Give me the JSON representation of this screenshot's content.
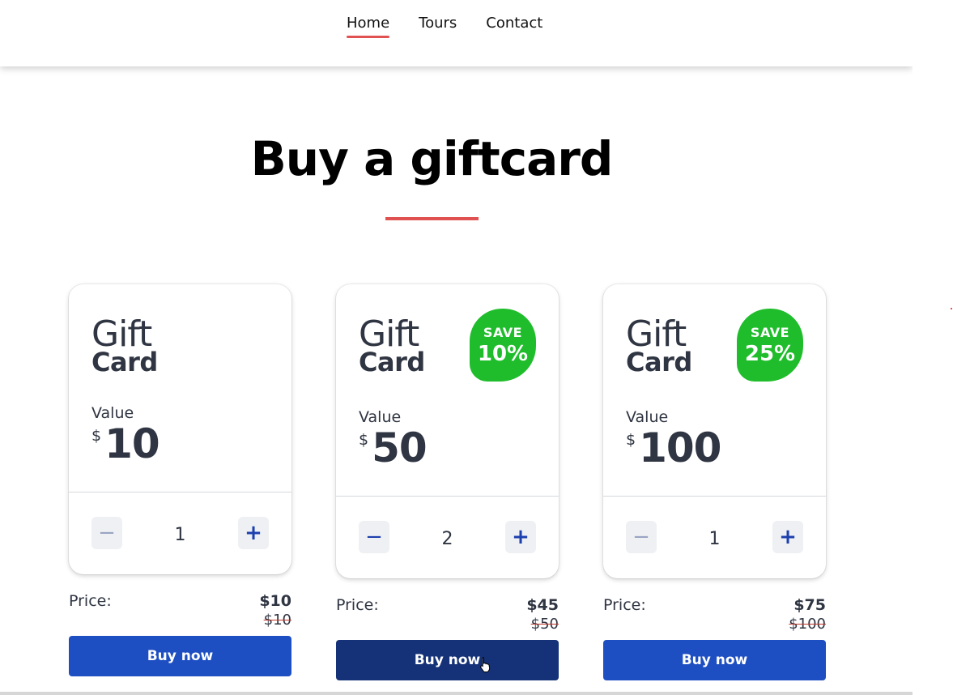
{
  "nav": {
    "items": [
      {
        "label": "Home"
      },
      {
        "label": "Tours"
      },
      {
        "label": "Contact"
      }
    ],
    "active_item": "Home",
    "accent_color": "#e05252"
  },
  "heading": "Buy a giftcard",
  "cards": [
    {
      "gift_word": "Gift",
      "card_word": "Card",
      "save_label": "",
      "save_pct": "",
      "value_label": "Value",
      "currency": "$",
      "amount": "10",
      "quantity": "1",
      "minus": "−",
      "plus": "+",
      "price_label": "Price:",
      "price_now": "$10",
      "price_old": "$10",
      "buy_label": "Buy now"
    },
    {
      "gift_word": "Gift",
      "card_word": "Card",
      "save_label": "SAVE",
      "save_pct": "10%",
      "value_label": "Value",
      "currency": "$",
      "amount": "50",
      "quantity": "2",
      "minus": "−",
      "plus": "+",
      "price_label": "Price:",
      "price_now": "$45",
      "price_old": "$50",
      "buy_label": "Buy now"
    },
    {
      "gift_word": "Gift",
      "card_word": "Card",
      "save_label": "SAVE",
      "save_pct": "25%",
      "value_label": "Value",
      "currency": "$",
      "amount": "100",
      "quantity": "1",
      "minus": "−",
      "plus": "+",
      "price_label": "Price:",
      "price_now": "$75",
      "price_old": "$100",
      "buy_label": "Buy now"
    }
  ],
  "colors": {
    "buy_button": "#1e4fc2",
    "buy_button_hover": "#153278",
    "save_badge": "#1fbd2b",
    "text": "#2f3542"
  }
}
